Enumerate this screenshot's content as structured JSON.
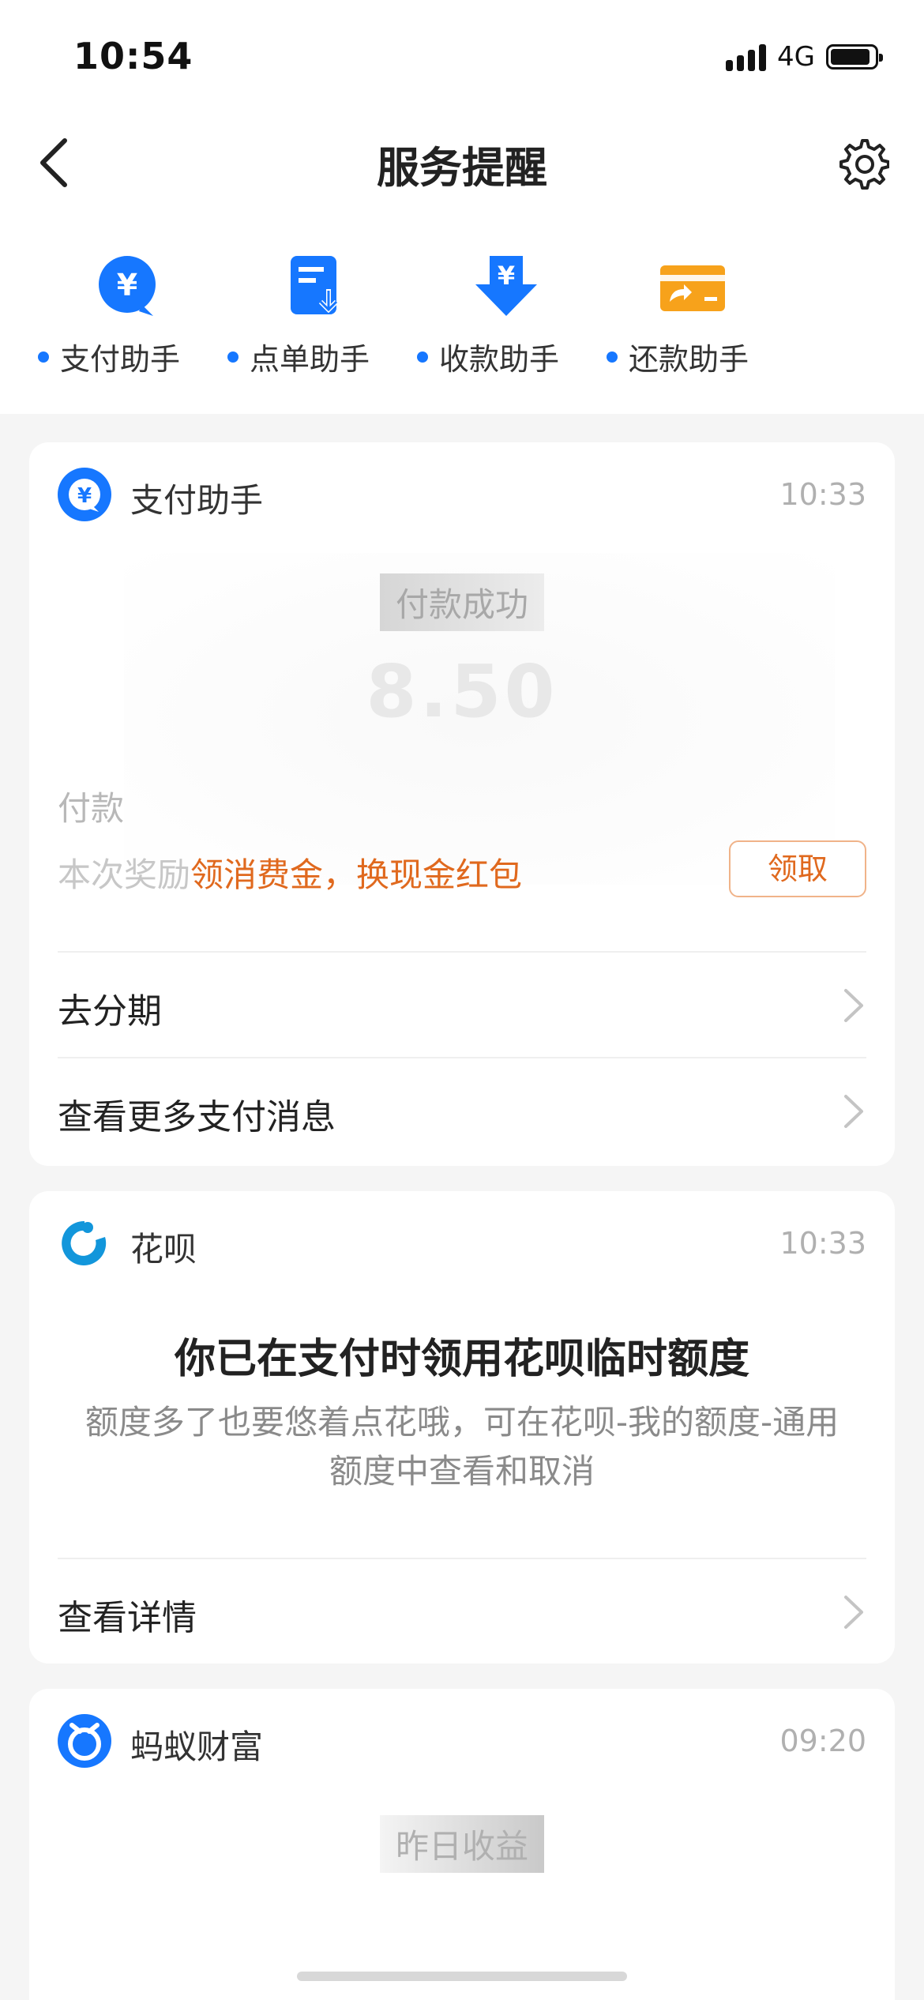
{
  "status_bar": {
    "time": "10:54",
    "network": "4G",
    "battery_level": 0.9
  },
  "nav": {
    "title": "服务提醒"
  },
  "quick_assistants": [
    {
      "label": "支付助手",
      "icon": "yuan-bubble-icon"
    },
    {
      "label": "点单助手",
      "icon": "order-doc-icon"
    },
    {
      "label": "收款助手",
      "icon": "receive-arrow-icon"
    },
    {
      "label": "还款助手",
      "icon": "repay-card-icon"
    }
  ],
  "cards": [
    {
      "name": "支付助手",
      "time": "10:33",
      "status_text": "付款成功",
      "amount": "8.50",
      "method_label": "付款",
      "reward_prefix": "本次奖励",
      "reward_text": "领消费金，换现金红包",
      "claim_label": "领取",
      "rows": [
        {
          "label": "去分期"
        },
        {
          "label": "查看更多支付消息"
        }
      ]
    },
    {
      "name": "花呗",
      "time": "10:33",
      "headline": "你已在支付时领用花呗临时额度",
      "description": "额度多了也要悠着点花哦，可在花呗-我的额度-通用额度中查看和取消",
      "rows": [
        {
          "label": "查看详情"
        }
      ]
    },
    {
      "name": "蚂蚁财富",
      "time": "09:20",
      "label": "昨日收益"
    }
  ],
  "colors": {
    "accent": "#1677ff",
    "reward": "#e0691e",
    "repay": "#f7a21b"
  }
}
